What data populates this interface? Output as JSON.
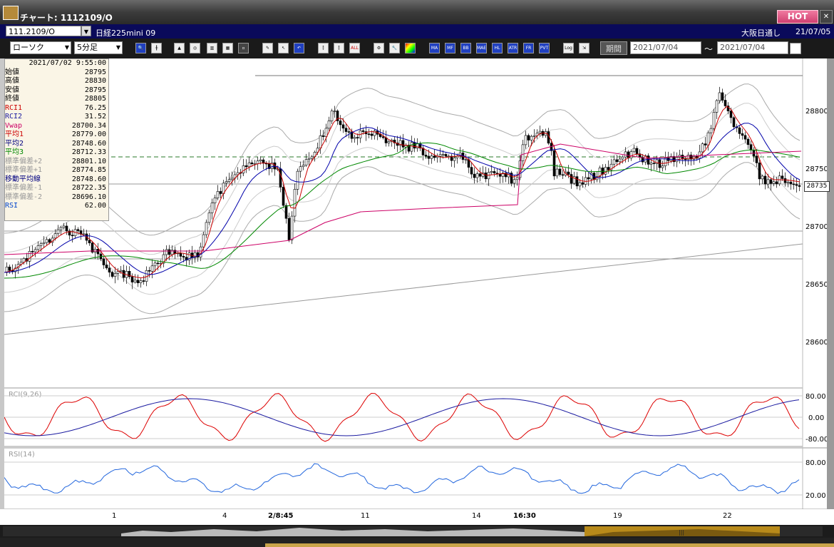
{
  "window": {
    "title": "チャート: 1112109/O",
    "hot_label": "HOT",
    "close_icon": "close-icon"
  },
  "header": {
    "symbol": "111.2109/O",
    "instrument": "日経225mini 09",
    "session": "大阪日通し",
    "date": "21/07/05"
  },
  "toolbar": {
    "chart_type": "ローソク",
    "interval": "5分足",
    "period_label": "期間",
    "date_from": "2021/07/04",
    "date_to": "2021/07/04",
    "tilde": "〜",
    "buttons": [
      "MA",
      "MF",
      "BB",
      "MAE",
      "HL",
      "ATR",
      "FR",
      "PVT",
      "Log"
    ]
  },
  "info": {
    "datetime": "2021/07/02 9:55:00",
    "rows": [
      {
        "label": "始値",
        "value": "28795",
        "color": "#000000"
      },
      {
        "label": "高値",
        "value": "28830",
        "color": "#000000"
      },
      {
        "label": "安値",
        "value": "28795",
        "color": "#000000"
      },
      {
        "label": "終値",
        "value": "28805",
        "color": "#000000"
      },
      {
        "label": "RCI1",
        "value": "76.25",
        "color": "#cc0000"
      },
      {
        "label": "RCI2",
        "value": "31.52",
        "color": "#1a1aa0"
      },
      {
        "label": "Vwap",
        "value": "28700.34",
        "color": "#cc0066"
      },
      {
        "label": "平均1",
        "value": "28779.00",
        "color": "#cc0000"
      },
      {
        "label": "平均2",
        "value": "28748.60",
        "color": "#000080"
      },
      {
        "label": "平均3",
        "value": "28712.33",
        "color": "#008800"
      },
      {
        "label": "標準偏差+2",
        "value": "28801.10",
        "color": "#999999"
      },
      {
        "label": "標準偏差+1",
        "value": "28774.85",
        "color": "#999999"
      },
      {
        "label": "移動平均線",
        "value": "28748.60",
        "color": "#000080"
      },
      {
        "label": "標準偏差-1",
        "value": "28722.35",
        "color": "#999999"
      },
      {
        "label": "標準偏差-2",
        "value": "28696.10",
        "color": "#999999"
      },
      {
        "label": "RSI",
        "value": "62.00",
        "color": "#0044cc"
      }
    ]
  },
  "price_axis": {
    "ticks": [
      "28800",
      "28750",
      "28700",
      "28650",
      "28600"
    ],
    "current_price": "28735"
  },
  "rci_panel": {
    "label": "RCI(9,26)",
    "ticks": [
      "80.00",
      "0.00",
      "-80.00"
    ]
  },
  "rsi_panel": {
    "label": "RSI(14)",
    "ticks": [
      "80.00",
      "20.00"
    ]
  },
  "time_axis": {
    "labels": [
      "1",
      "4",
      "2/8:45",
      "11",
      "14",
      "16:30",
      "19",
      "22"
    ]
  },
  "scroll": {
    "thumb_icon": "grip-icon"
  }
}
